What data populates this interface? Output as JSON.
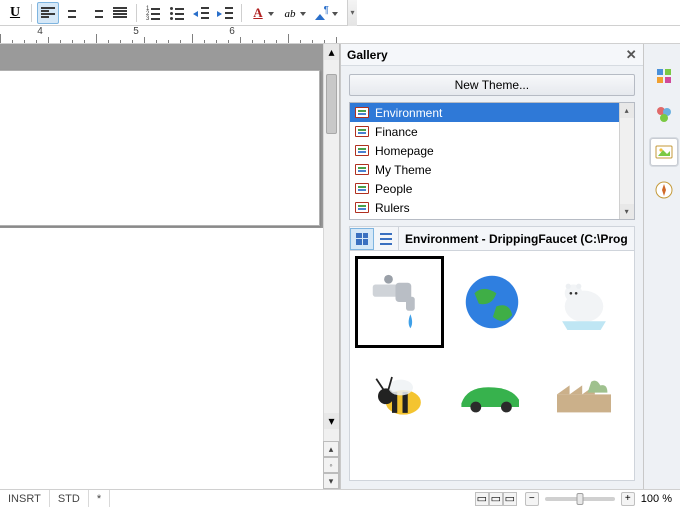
{
  "toolbar": {
    "underline_letter": "U"
  },
  "ruler": {
    "numbers": [
      4,
      5,
      6
    ]
  },
  "gallery": {
    "title": "Gallery",
    "new_theme_label": "New Theme...",
    "themes": [
      "Environment",
      "Finance",
      "Homepage",
      "My Theme",
      "People",
      "Rulers"
    ],
    "selected_index": 0,
    "path_label": "Environment - DrippingFaucet (C:\\Prog",
    "items": [
      "DrippingFaucet",
      "Earth",
      "PolarBear",
      "Bee",
      "GreenCar",
      "Factory"
    ]
  },
  "sidebar": {
    "items": [
      "properties",
      "styles",
      "gallery",
      "navigator"
    ],
    "active_index": 2
  },
  "status": {
    "insert_mode": "INSRT",
    "selection_mode": "STD",
    "modified": "*",
    "zoom_value": "100 %"
  }
}
